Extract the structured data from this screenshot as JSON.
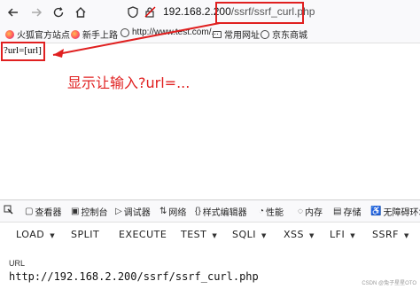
{
  "browser": {
    "url_host": "192.168.2.200",
    "url_path": "/ssrf/ssrf_curl.php",
    "colors": {
      "annotation_red": "#e02020",
      "toolbar_bg": "#f9f9fb"
    }
  },
  "bookmarks": [
    {
      "label": "火狐官方站点",
      "icon": "firefox-icon"
    },
    {
      "label": "新手上路",
      "icon": "firefox-icon"
    },
    {
      "label": "http://www.test.com/...",
      "icon": "globe-icon"
    },
    {
      "label": "常用网址",
      "icon": "folder-icon"
    },
    {
      "label": "京东商城",
      "icon": "globe-icon"
    }
  ],
  "page": {
    "query_text": "?url=[url]",
    "annotation": "显示让输入?url=..."
  },
  "devtools": {
    "tabs": [
      {
        "label": "查看器",
        "icon": "inspector-icon"
      },
      {
        "label": "控制台",
        "icon": "console-icon"
      },
      {
        "label": "调试器",
        "icon": "debugger-icon"
      },
      {
        "label": "网络",
        "icon": "network-icon"
      },
      {
        "label": "样式编辑器",
        "icon": "style-icon"
      },
      {
        "label": "性能",
        "icon": "performance-icon"
      },
      {
        "label": "内存",
        "icon": "memory-icon"
      },
      {
        "label": "存储",
        "icon": "storage-icon"
      },
      {
        "label": "无障碍环境",
        "icon": "accessibility-icon"
      }
    ]
  },
  "hackbar": {
    "buttons": [
      {
        "label": "LOAD",
        "dropdown": true
      },
      {
        "label": "SPLIT",
        "dropdown": false
      },
      {
        "label": "EXECUTE",
        "dropdown": false
      },
      {
        "label": "TEST",
        "dropdown": true
      },
      {
        "label": "SQLI",
        "dropdown": true
      },
      {
        "label": "XSS",
        "dropdown": true
      },
      {
        "label": "LFI",
        "dropdown": true
      },
      {
        "label": "SSRF",
        "dropdown": true
      }
    ],
    "url_label": "URL",
    "url_value": "http://192.168.2.200/ssrf/ssrf_curl.php"
  },
  "watermark": "CSDN @兔子星星OTO"
}
